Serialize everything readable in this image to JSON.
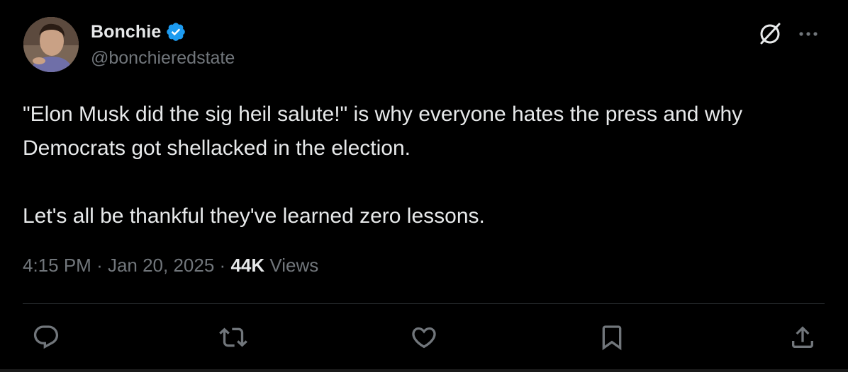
{
  "author": {
    "display_name": "Bonchie",
    "handle": "@bonchieredstate",
    "verified": true,
    "badge_color": "#1d9bf0"
  },
  "tweet": {
    "paragraphs": [
      "\"Elon Musk did the sig heil salute!\" is why everyone hates the press and why Democrats got shellacked in the election.",
      "Let's all be thankful they've learned zero lessons."
    ]
  },
  "meta": {
    "time": "4:15 PM",
    "separator": "·",
    "date": "Jan 20, 2025",
    "views_count": "44K",
    "views_label": "Views"
  },
  "actions": {
    "icons": [
      "reply-icon",
      "retweet-icon",
      "like-icon",
      "bookmark-icon",
      "share-icon"
    ]
  },
  "top_icons": [
    "grok-icon",
    "more-icon"
  ],
  "colors": {
    "background": "#000000",
    "primary_text": "#e7e9ea",
    "secondary_text": "#71767b",
    "divider": "#2f3336"
  }
}
